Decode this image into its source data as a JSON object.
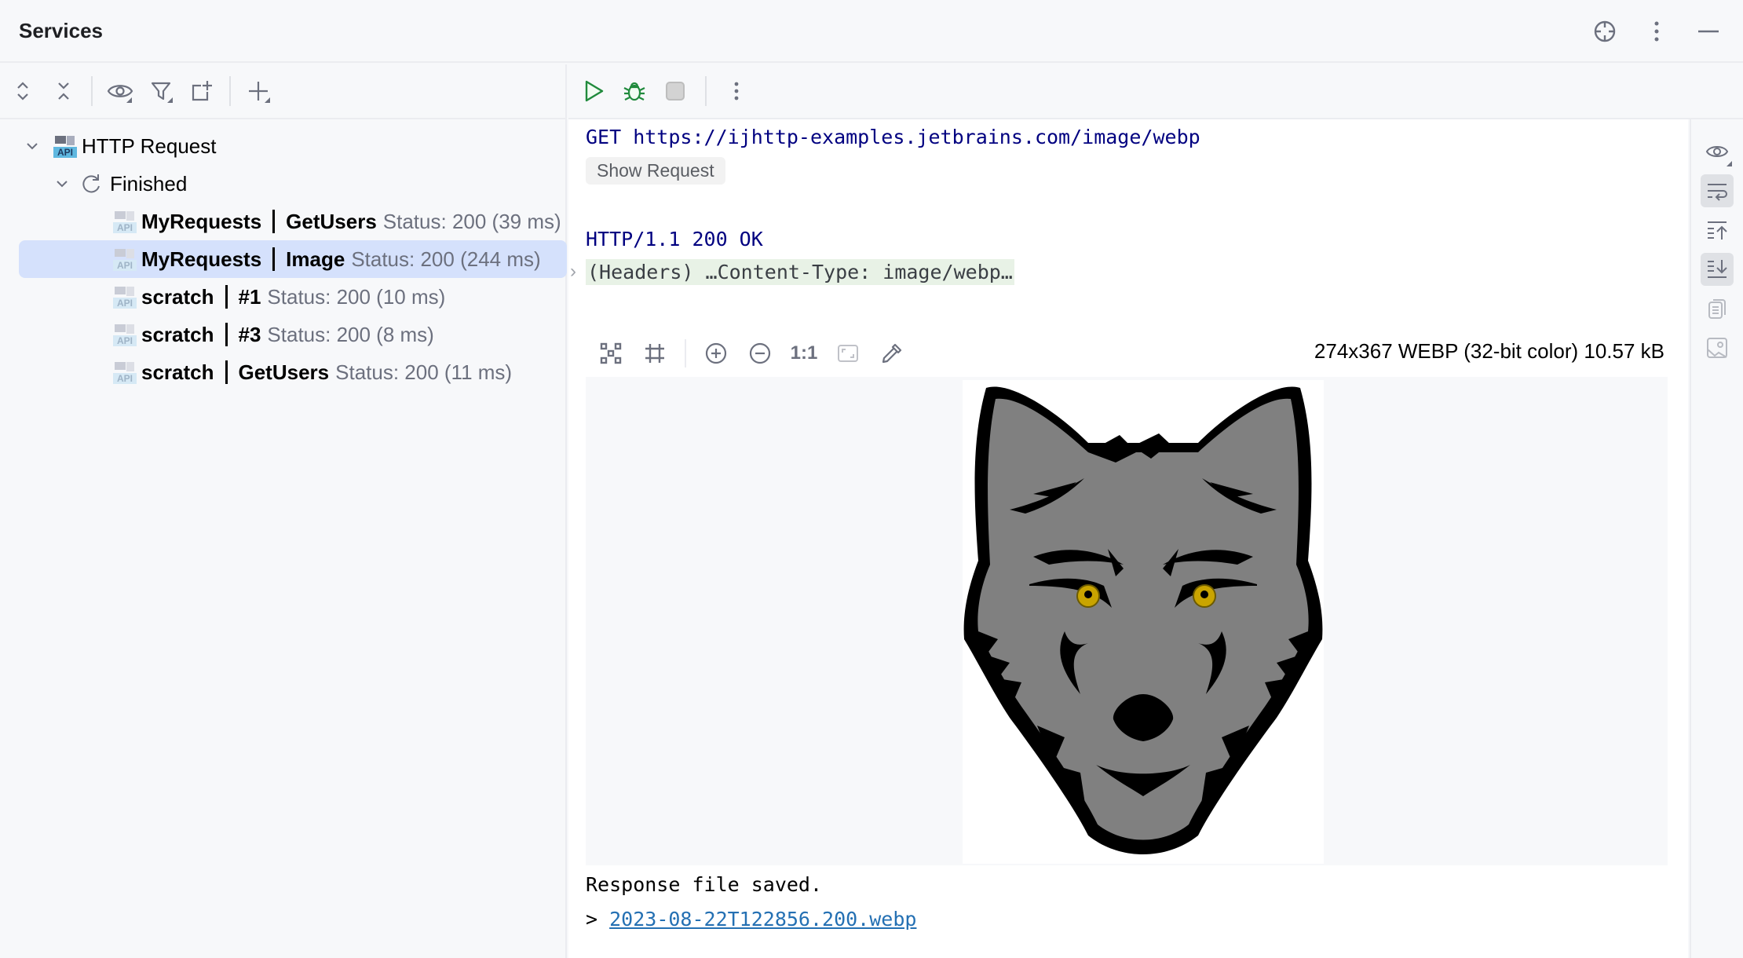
{
  "window": {
    "title": "Services",
    "actions": [
      {
        "name": "locate-icon",
        "label": "Select Opened"
      },
      {
        "name": "more-icon",
        "label": "Options"
      },
      {
        "name": "minimize-icon",
        "label": "Hide"
      }
    ]
  },
  "left_toolbar": {
    "buttons": [
      "expand-all",
      "collapse-all",
      "view-options",
      "filter",
      "new-group",
      "add-service"
    ]
  },
  "tree": {
    "root": {
      "label": "HTTP Request",
      "expanded": true
    },
    "group": {
      "label": "Finished",
      "expanded": true
    },
    "items": [
      {
        "file": "MyRequests",
        "name": "GetUsers",
        "status": "Status: 200 (39 ms)",
        "selected": false
      },
      {
        "file": "MyRequests",
        "name": "Image",
        "status": "Status: 200 (244 ms)",
        "selected": true
      },
      {
        "file": "scratch",
        "name": "#1",
        "status": "Status: 200 (10 ms)",
        "selected": false
      },
      {
        "file": "scratch",
        "name": "#3",
        "status": "Status: 200 (8 ms)",
        "selected": false
      },
      {
        "file": "scratch",
        "name": "GetUsers",
        "status": "Status: 200 (11 ms)",
        "selected": false
      }
    ],
    "api_badge": "API"
  },
  "right_toolbar": {
    "buttons": [
      "run",
      "debug",
      "stop",
      "more"
    ]
  },
  "response": {
    "request_line": "GET https://ijhttp-examples.jetbrains.com/image/webp",
    "show_request": "Show Request",
    "status_line": "HTTP/1.1 200 OK",
    "headers_fold": "(Headers) …Content-Type: image/webp…",
    "fold_marker": "›",
    "saved_text": "Response file saved.",
    "saved_prefix": "> ",
    "saved_file": "2023-08-22T122856.200.webp"
  },
  "image_viewer": {
    "zoom_actual": "1:1",
    "info": "274x367 WEBP (32-bit color) 10.57 kB",
    "tools": [
      "toggle-grid",
      "toggle-chessboard",
      "zoom-in",
      "zoom-out",
      "actual-size",
      "fit-zoom",
      "color-picker"
    ]
  },
  "side_toolbar": {
    "buttons": [
      {
        "name": "view-icon",
        "active": false
      },
      {
        "name": "soft-wrap-icon",
        "active": true
      },
      {
        "name": "scroll-to-top-icon",
        "active": false
      },
      {
        "name": "scroll-to-end-icon",
        "active": true
      },
      {
        "name": "copy-icon",
        "active": false
      },
      {
        "name": "image-icon",
        "active": false
      }
    ]
  },
  "colors": {
    "selection": "#d5e1fc",
    "run_green": "#208a3c",
    "link_blue": "#2470b3",
    "keyword_navy": "#000080",
    "headers_bg": "#e8f2e6",
    "wolf_fur": "#808080",
    "wolf_eye": "#c9a400"
  }
}
